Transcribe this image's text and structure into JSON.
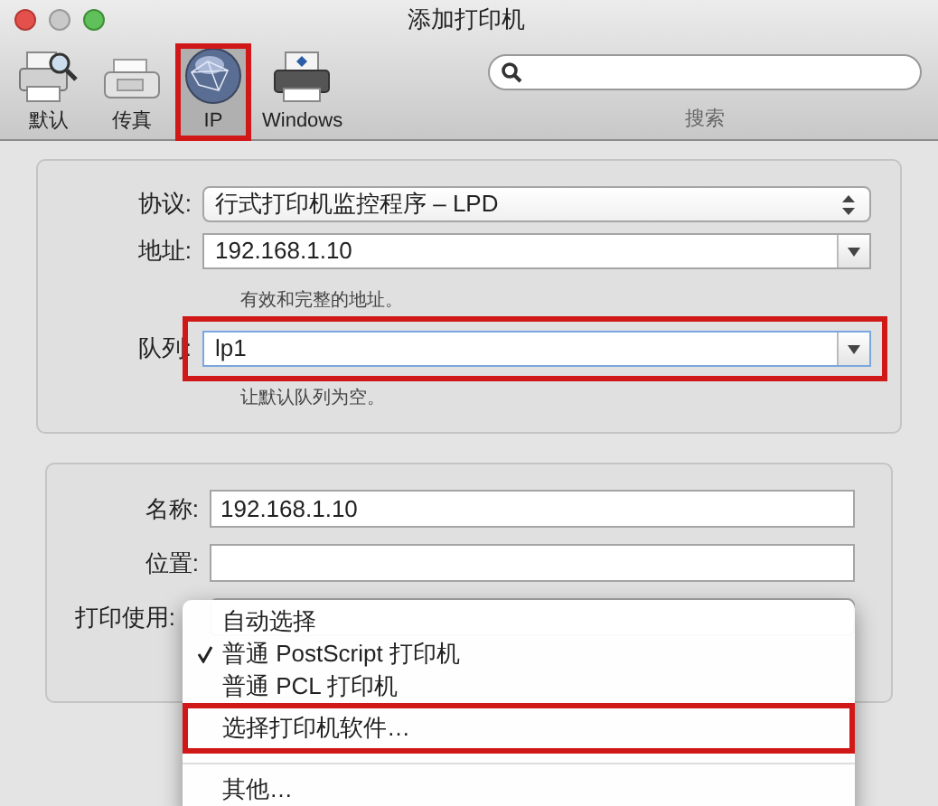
{
  "window": {
    "title": "添加打印机"
  },
  "toolbar": [
    {
      "label": "默认",
      "selected": false,
      "highlight": false
    },
    {
      "label": "传真",
      "selected": false,
      "highlight": false
    },
    {
      "label": "IP",
      "selected": true,
      "highlight": true
    },
    {
      "label": "Windows",
      "selected": false,
      "highlight": false
    }
  ],
  "search": {
    "label": "搜索"
  },
  "connection": [
    {
      "label": "协议:",
      "kind": "popup",
      "value": "行式打印机监控程序 – LPD",
      "highlight": false
    },
    {
      "label": "地址:",
      "kind": "combo",
      "value": "192.168.1.10",
      "hint": "有效和完整的地址。",
      "highlight": false
    },
    {
      "label": "队列:",
      "kind": "combo",
      "value": "lp1",
      "hint": "让默认队列为空。",
      "highlight": true
    }
  ],
  "details": [
    {
      "label": "名称:",
      "value": "192.168.1.10"
    },
    {
      "label": "位置:"
    }
  ],
  "print_using": {
    "label": "打印使用:"
  },
  "menu": [
    {
      "label": "自动选择",
      "checked": false,
      "highlight": false,
      "separator_before": false
    },
    {
      "label": "普通 PostScript 打印机",
      "checked": true,
      "highlight": false,
      "separator_before": false
    },
    {
      "label": "普通 PCL 打印机",
      "checked": false,
      "highlight": false,
      "separator_before": false
    },
    {
      "label": "选择打印机软件…",
      "checked": false,
      "highlight": true,
      "separator_before": false
    },
    {
      "label": "其他…",
      "checked": false,
      "highlight": false,
      "separator_before": true
    }
  ]
}
